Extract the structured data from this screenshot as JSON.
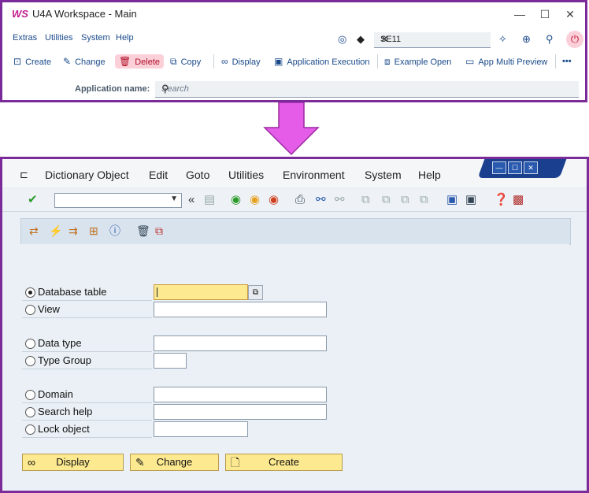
{
  "top_window": {
    "title": "U4A Workspace - Main",
    "logo_text": "WS",
    "window_controls": [
      "—",
      "☐",
      "✕"
    ],
    "menu": [
      "Extras",
      "Utilities",
      "System",
      "Help"
    ],
    "search_value": "SE11",
    "actions": {
      "create": "Create",
      "change": "Change",
      "delete": "Delete",
      "copy": "Copy",
      "display": "Display",
      "app_exec": "Application Execution",
      "example_open": "Example Open",
      "multi_preview": "App Multi Preview"
    },
    "app_name_label": "Application name:",
    "app_name_placeholder": "Search"
  },
  "sap_window": {
    "menu": {
      "dictionary_object": "Dictionary Object",
      "edit": "Edit",
      "goto": "Goto",
      "utilities": "Utilities",
      "environment": "Environment",
      "system": "System",
      "help": "Help"
    },
    "options": {
      "database_table": "Database table",
      "view": "View",
      "data_type": "Data type",
      "type_group": "Type Group",
      "domain": "Domain",
      "search_help": "Search help",
      "lock_object": "Lock object"
    },
    "buttons": {
      "display": "Display",
      "change": "Change",
      "create": "Create"
    }
  },
  "colors": {
    "frame": "#7b2a9a",
    "arrow": "#e45ce8",
    "sap_background": "#eaf0f5",
    "button_yellow": "#fde990",
    "delete_bg": "#fbd0d8"
  }
}
